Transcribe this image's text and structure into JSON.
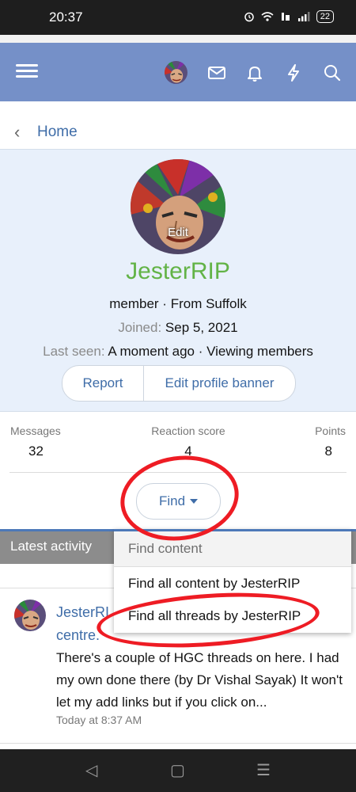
{
  "status_bar": {
    "time": "20:37",
    "battery": "22"
  },
  "breadcrumb": {
    "home": "Home"
  },
  "profile": {
    "avatar_overlay": "Edit",
    "username": "JesterRIP",
    "role_location": "member · From Suffolk",
    "joined_label": "Joined:",
    "joined_value": "Sep 5, 2021",
    "last_seen_label": "Last seen:",
    "last_seen_value": "A moment ago · Viewing members",
    "report_button": "Report",
    "edit_banner_button": "Edit profile banner"
  },
  "stats": [
    {
      "label": "Messages",
      "value": "32"
    },
    {
      "label": "Reaction score",
      "value": "4"
    },
    {
      "label": "Points",
      "value": "8"
    }
  ],
  "find_button": "Find",
  "tab": {
    "label": "Latest activity"
  },
  "dropdown": {
    "header": "Find content",
    "items": [
      "Find all content by JesterRIP",
      "Find all threads by JesterRIP"
    ]
  },
  "post": {
    "title_line1": "JesterRI",
    "title_line2": "centre.",
    "body": "There's a couple of HGC threads on here. I had my own done there (by Dr Vishal Sayak) It won't let my add links but if you click on...",
    "time": "Today at 8:37 AM"
  },
  "colors": {
    "nav": "#7590c8",
    "accent": "#4c78b8",
    "username": "#62b346",
    "annotation": "#ee1c24"
  }
}
